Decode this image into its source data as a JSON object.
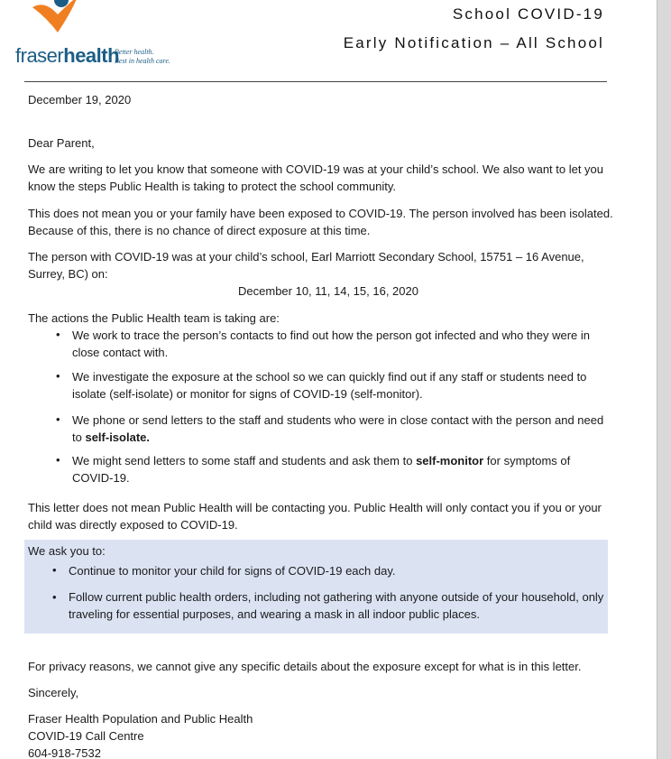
{
  "header": {
    "logo_name_light": "fraser",
    "logo_name_bold": "health",
    "logo_tagline_1": "Better health.",
    "logo_tagline_2": "Best in health care.",
    "title_line_1": "School COVID-19",
    "title_line_2": "Early Notification – All School"
  },
  "colors": {
    "brand_blue": "#1b5d86",
    "brand_orange": "#f07f22",
    "highlight_box": "#dbe3f3"
  },
  "letter": {
    "date": "December 19, 2020",
    "greeting": "Dear Parent,",
    "para1": "We are writing to let you know that someone with COVID-19 was at your child’s school. We also want to let you know the steps Public Health is taking to protect the school community.",
    "para2": "This does not mean you or your family have been exposed to COVID-19. The person involved has been isolated. Because of this, there is no chance of direct exposure at this time.",
    "para3": "The person with COVID-19 was at your child’s school, Earl Marriott Secondary School, 15751 – 16 Avenue, Surrey, BC) on:",
    "exposure_dates": "December 10, 11, 14, 15, 16, 2020",
    "actions_intro": "The actions the Public Health team is taking are:",
    "actions": [
      {
        "text": "We work to trace the person’s contacts to find out how the person got infected and who they were in close contact with."
      },
      {
        "text": "We investigate the exposure at the school so we can quickly find out if any staff or students need to isolate (self-isolate) or monitor for signs of COVID-19 (self-monitor)."
      },
      {
        "text_before": "We phone or send letters to the staff and students who were in close contact with the person and need to ",
        "bold": "self-isolate.",
        "text_after": ""
      },
      {
        "text_before": "We might send letters to some staff and students and ask them to ",
        "bold": "self-monitor",
        "text_after": " for symptoms of COVID-19."
      }
    ],
    "para4": "This letter does not mean Public Health will be contacting you. Public Health will only contact you if you or your child was directly exposed to COVID-19.",
    "ask_intro": "We ask you to:",
    "asks": [
      "Continue to monitor your child for signs of COVID-19 each day.",
      "Follow current public health orders, including not gathering with anyone outside of your household, only traveling for essential purposes, and wearing a mask in all indoor public places."
    ],
    "privacy": "For privacy reasons, we cannot give any specific details about the exposure except for what is in this letter.",
    "closing": "Sincerely,",
    "signature_1": "Fraser Health Population and Public Health",
    "signature_2": "COVID-19 Call Centre",
    "signature_3": "604-918-7532"
  }
}
